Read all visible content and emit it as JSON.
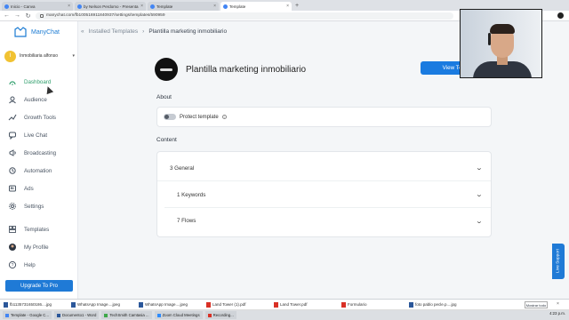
{
  "browser": {
    "tabs": [
      {
        "title": "Inicio - Canva"
      },
      {
        "title": "by Nelson Perdomo - Presenta"
      },
      {
        "title": "Template"
      },
      {
        "title": "Template"
      }
    ],
    "new_tab": "+",
    "url": "manychat.com/fb100516911840937/settings/templates/590959"
  },
  "sidebar": {
    "brand": "ManyChat",
    "account": {
      "name": "Inmobiliaria alfonso",
      "initial": "I"
    },
    "nav": [
      {
        "label": "Dashboard",
        "icon": "dashboard-icon",
        "active": true
      },
      {
        "label": "Audience",
        "icon": "audience-icon"
      },
      {
        "label": "Growth Tools",
        "icon": "growth-tools-icon"
      },
      {
        "label": "Live Chat",
        "icon": "live-chat-icon"
      },
      {
        "label": "Broadcasting",
        "icon": "broadcasting-icon"
      },
      {
        "label": "Automation",
        "icon": "automation-icon"
      },
      {
        "label": "Ads",
        "icon": "ads-icon"
      },
      {
        "label": "Settings",
        "icon": "settings-icon"
      }
    ],
    "nav_bottom": [
      {
        "label": "Templates",
        "icon": "templates-icon"
      },
      {
        "label": "My Profile",
        "icon": "profile-icon"
      },
      {
        "label": "Help",
        "icon": "help-icon"
      }
    ],
    "upgrade": "Upgrade To Pro"
  },
  "main": {
    "collapse_glyph": "«",
    "breadcrumb": {
      "root": "Installed Templates",
      "separator": "›",
      "current": "Plantilla marketing inmobiliario"
    },
    "template_title": "Plantilla marketing inmobiliario",
    "view_button": "View Template",
    "about_title": "About",
    "protect_label": "Protect template",
    "content_title": "Content",
    "content_rows": [
      {
        "label": "3 General"
      },
      {
        "label": "1 Keywords"
      },
      {
        "label": "7 Flows"
      }
    ],
    "live_support": "Live Support"
  },
  "downloads": {
    "items": [
      {
        "name": "fb1135731650186....jpg",
        "type": "img"
      },
      {
        "name": "WhatsApp Image....jpeg",
        "type": "img"
      },
      {
        "name": "WhatsApp Image....jpeg",
        "type": "img"
      },
      {
        "name": "Land Tower (1).pdf",
        "type": "pdf"
      },
      {
        "name": "Land Tower.pdf",
        "type": "pdf"
      },
      {
        "name": "Formulario",
        "type": "pdf"
      },
      {
        "name": "foto pablo pecle.p....jpg",
        "type": "img"
      }
    ],
    "show_all": "Mostrar todo"
  },
  "taskbar": {
    "items": [
      {
        "label": "Template - Google C...",
        "color": "#4285f4"
      },
      {
        "label": "Documento1 - Word",
        "color": "#2b579a"
      },
      {
        "label": "TechSmith Camtasia ...",
        "color": "#3ea84a"
      },
      {
        "label": "Zoom Cloud Meetings",
        "color": "#2d8cff"
      },
      {
        "label": "Recording...",
        "color": "#d93025"
      }
    ],
    "clock": "4:23 p.m."
  }
}
